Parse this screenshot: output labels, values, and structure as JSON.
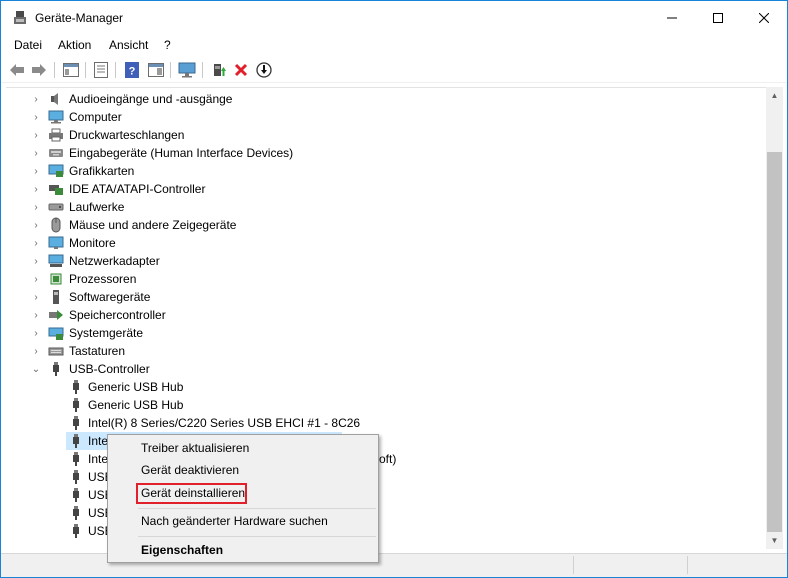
{
  "window": {
    "title": "Geräte-Manager"
  },
  "menu": {
    "items": [
      "Datei",
      "Aktion",
      "Ansicht",
      "?"
    ]
  },
  "toolbar": {
    "buttons": [
      "back-icon",
      "forward-icon",
      "show-hide-console-tree-icon",
      "properties-icon",
      "help-icon",
      "action-pane-icon",
      "monitor-icon",
      "update-driver-icon",
      "uninstall-icon",
      "disable-icon"
    ]
  },
  "tree": {
    "categories": [
      {
        "label": "Audioeingänge und -ausgänge",
        "icon": "speaker-icon"
      },
      {
        "label": "Computer",
        "icon": "computer-icon"
      },
      {
        "label": "Druckwarteschlangen",
        "icon": "printer-icon"
      },
      {
        "label": "Eingabegeräte (Human Interface Devices)",
        "icon": "hid-icon"
      },
      {
        "label": "Grafikkarten",
        "icon": "display-adapter-icon"
      },
      {
        "label": "IDE ATA/ATAPI-Controller",
        "icon": "ide-controller-icon"
      },
      {
        "label": "Laufwerke",
        "icon": "disk-drive-icon"
      },
      {
        "label": "Mäuse und andere Zeigegeräte",
        "icon": "mouse-icon"
      },
      {
        "label": "Monitore",
        "icon": "monitor-icon"
      },
      {
        "label": "Netzwerkadapter",
        "icon": "network-adapter-icon"
      },
      {
        "label": "Prozessoren",
        "icon": "processor-icon"
      },
      {
        "label": "Softwaregeräte",
        "icon": "software-device-icon"
      },
      {
        "label": "Speichercontroller",
        "icon": "storage-controller-icon"
      },
      {
        "label": "Systemgeräte",
        "icon": "system-device-icon"
      },
      {
        "label": "Tastaturen",
        "icon": "keyboard-icon"
      },
      {
        "label": "USB-Controller",
        "icon": "usb-icon"
      }
    ],
    "usb_children": [
      "Generic USB Hub",
      "Generic USB Hub",
      "Intel(R) 8 Series/C220 Series USB EHCI #1 - 8C26",
      "Inte",
      "Inte",
      "USB",
      "USB",
      "USB",
      "USB"
    ],
    "partial_suffix": "oft)"
  },
  "context_menu": {
    "update_driver": "Treiber aktualisieren",
    "disable": "Gerät deaktivieren",
    "uninstall": "Gerät deinstallieren",
    "scan": "Nach geänderter Hardware suchen",
    "properties": "Eigenschaften",
    "highlight_color": "#e0202a"
  },
  "colors": {
    "window_border": "#1883d7",
    "selection": "#cce8ff",
    "menu_bg": "#f0f0f0"
  }
}
